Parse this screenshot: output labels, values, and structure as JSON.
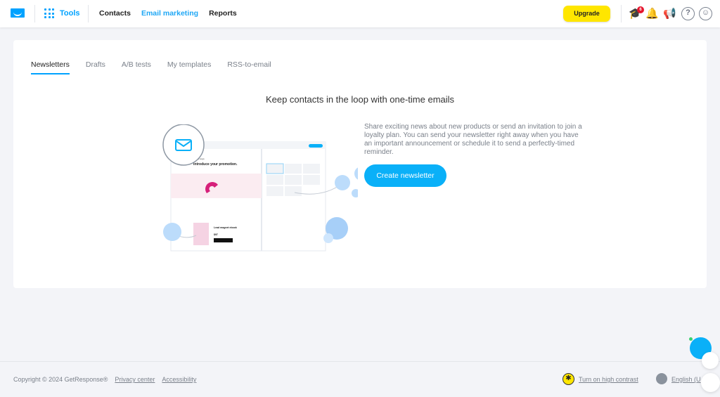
{
  "header": {
    "tools_label": "Tools",
    "nav": [
      {
        "label": "Contacts"
      },
      {
        "label": "Email marketing"
      },
      {
        "label": "Reports"
      }
    ],
    "upgrade_label": "Upgrade",
    "notification_badge": "6",
    "icons": [
      "graduation-cap-icon",
      "bell-icon",
      "megaphone-icon",
      "help-icon",
      "account-icon"
    ]
  },
  "tabs": [
    {
      "label": "Newsletters"
    },
    {
      "label": "Drafts"
    },
    {
      "label": "A/B tests"
    },
    {
      "label": "My templates"
    },
    {
      "label": "RSS-to-email"
    }
  ],
  "main": {
    "heading": "Keep contacts in the loop with one-time emails",
    "description": "Share exciting news about new products or send an invitation to join a loyalty plan. You can send your newsletter right away when you have an important announcement or schedule it to send a perfectly-timed reminder.",
    "cta": "Create newsletter",
    "illustration": {
      "brand": "Brand Logo",
      "title": "Introduce your promotion.",
      "product": "Lead magnet ebook",
      "price": "$97"
    }
  },
  "footer": {
    "copyright": "Copyright © 2024 GetResponse®",
    "privacy": "Privacy center",
    "accessibility": "Accessibility",
    "contrast": "Turn on high contrast",
    "language": "English (U"
  },
  "colors": {
    "accent": "#00a2ff",
    "upgrade": "#ffe600",
    "badge": "#e5142c"
  }
}
